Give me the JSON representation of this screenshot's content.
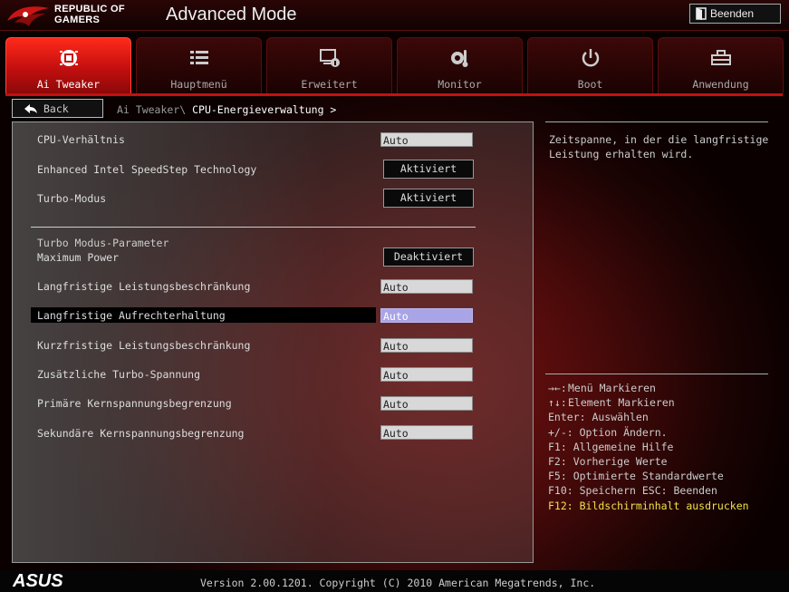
{
  "brand": {
    "line1": "REPUBLIC OF",
    "line2": "GAMERS",
    "footer_logo": "ASUS"
  },
  "header": {
    "title": "Advanced Mode",
    "exit_label": "Beenden"
  },
  "tabs": [
    {
      "label": "Ai Tweaker",
      "icon": "ai-tweaker-icon",
      "active": true
    },
    {
      "label": "Hauptmenü",
      "icon": "list-icon",
      "active": false
    },
    {
      "label": "Erweitert",
      "icon": "advanced-icon",
      "active": false
    },
    {
      "label": "Monitor",
      "icon": "monitor-icon",
      "active": false
    },
    {
      "label": "Boot",
      "icon": "power-icon",
      "active": false
    },
    {
      "label": "Anwendung",
      "icon": "tool-icon",
      "active": false
    }
  ],
  "nav": {
    "back_label": "Back",
    "breadcrumb_parent": "Ai Tweaker\\",
    "breadcrumb_current": "CPU-Energieverwaltung >"
  },
  "settings": {
    "cpu_ratio": {
      "label": "CPU-Verhältnis",
      "value": "Auto"
    },
    "speedstep": {
      "label": "Enhanced Intel SpeedStep Technology",
      "value": "Aktiviert"
    },
    "turbo_mode": {
      "label": "Turbo-Modus",
      "value": "Aktiviert"
    },
    "section_title": "Turbo Modus-Parameter",
    "max_power": {
      "label": "Maximum Power",
      "value": "Deaktiviert"
    },
    "long_power_limit": {
      "label": "Langfristige Leistungsbeschränkung",
      "value": "Auto"
    },
    "long_duration": {
      "label": "Langfristige Aufrechterhaltung",
      "value": "Auto",
      "selected": true
    },
    "short_power_limit": {
      "label": "Kurzfristige Leistungsbeschränkung",
      "value": "Auto"
    },
    "extra_turbo_voltage": {
      "label": "Zusätzliche Turbo-Spannung",
      "value": "Auto"
    },
    "primary_core_limit": {
      "label": "Primäre Kernspannungsbegrenzung",
      "value": "Auto"
    },
    "secondary_core_limit": {
      "label": "Sekundäre Kernspannungsbegrenzung",
      "value": "Auto"
    }
  },
  "help": {
    "description": "Zeitspanne, in der die langfristige Leistung erhalten wird."
  },
  "keys": {
    "k1_key": "→←:",
    "k1": "Menü Markieren",
    "k2_key": "↑↓:",
    "k2": "Element Markieren",
    "k3": "Enter: Auswählen",
    "k4": "+/-: Option Ändern.",
    "k5": "F1: Allgemeine Hilfe",
    "k6": "F2: Vorherige Werte",
    "k7": "F5: Optimierte Standardwerte",
    "k8": "F10: Speichern  ESC: Beenden",
    "k9": "F12: Bildschirminhalt ausdrucken"
  },
  "footer": {
    "version": "Version 2.00.1201. Copyright (C) 2010 American Megatrends, Inc."
  },
  "colors": {
    "accent": "#c41010",
    "selected_value": "#a9a4e6",
    "highlight_key": "#f0e24a"
  }
}
